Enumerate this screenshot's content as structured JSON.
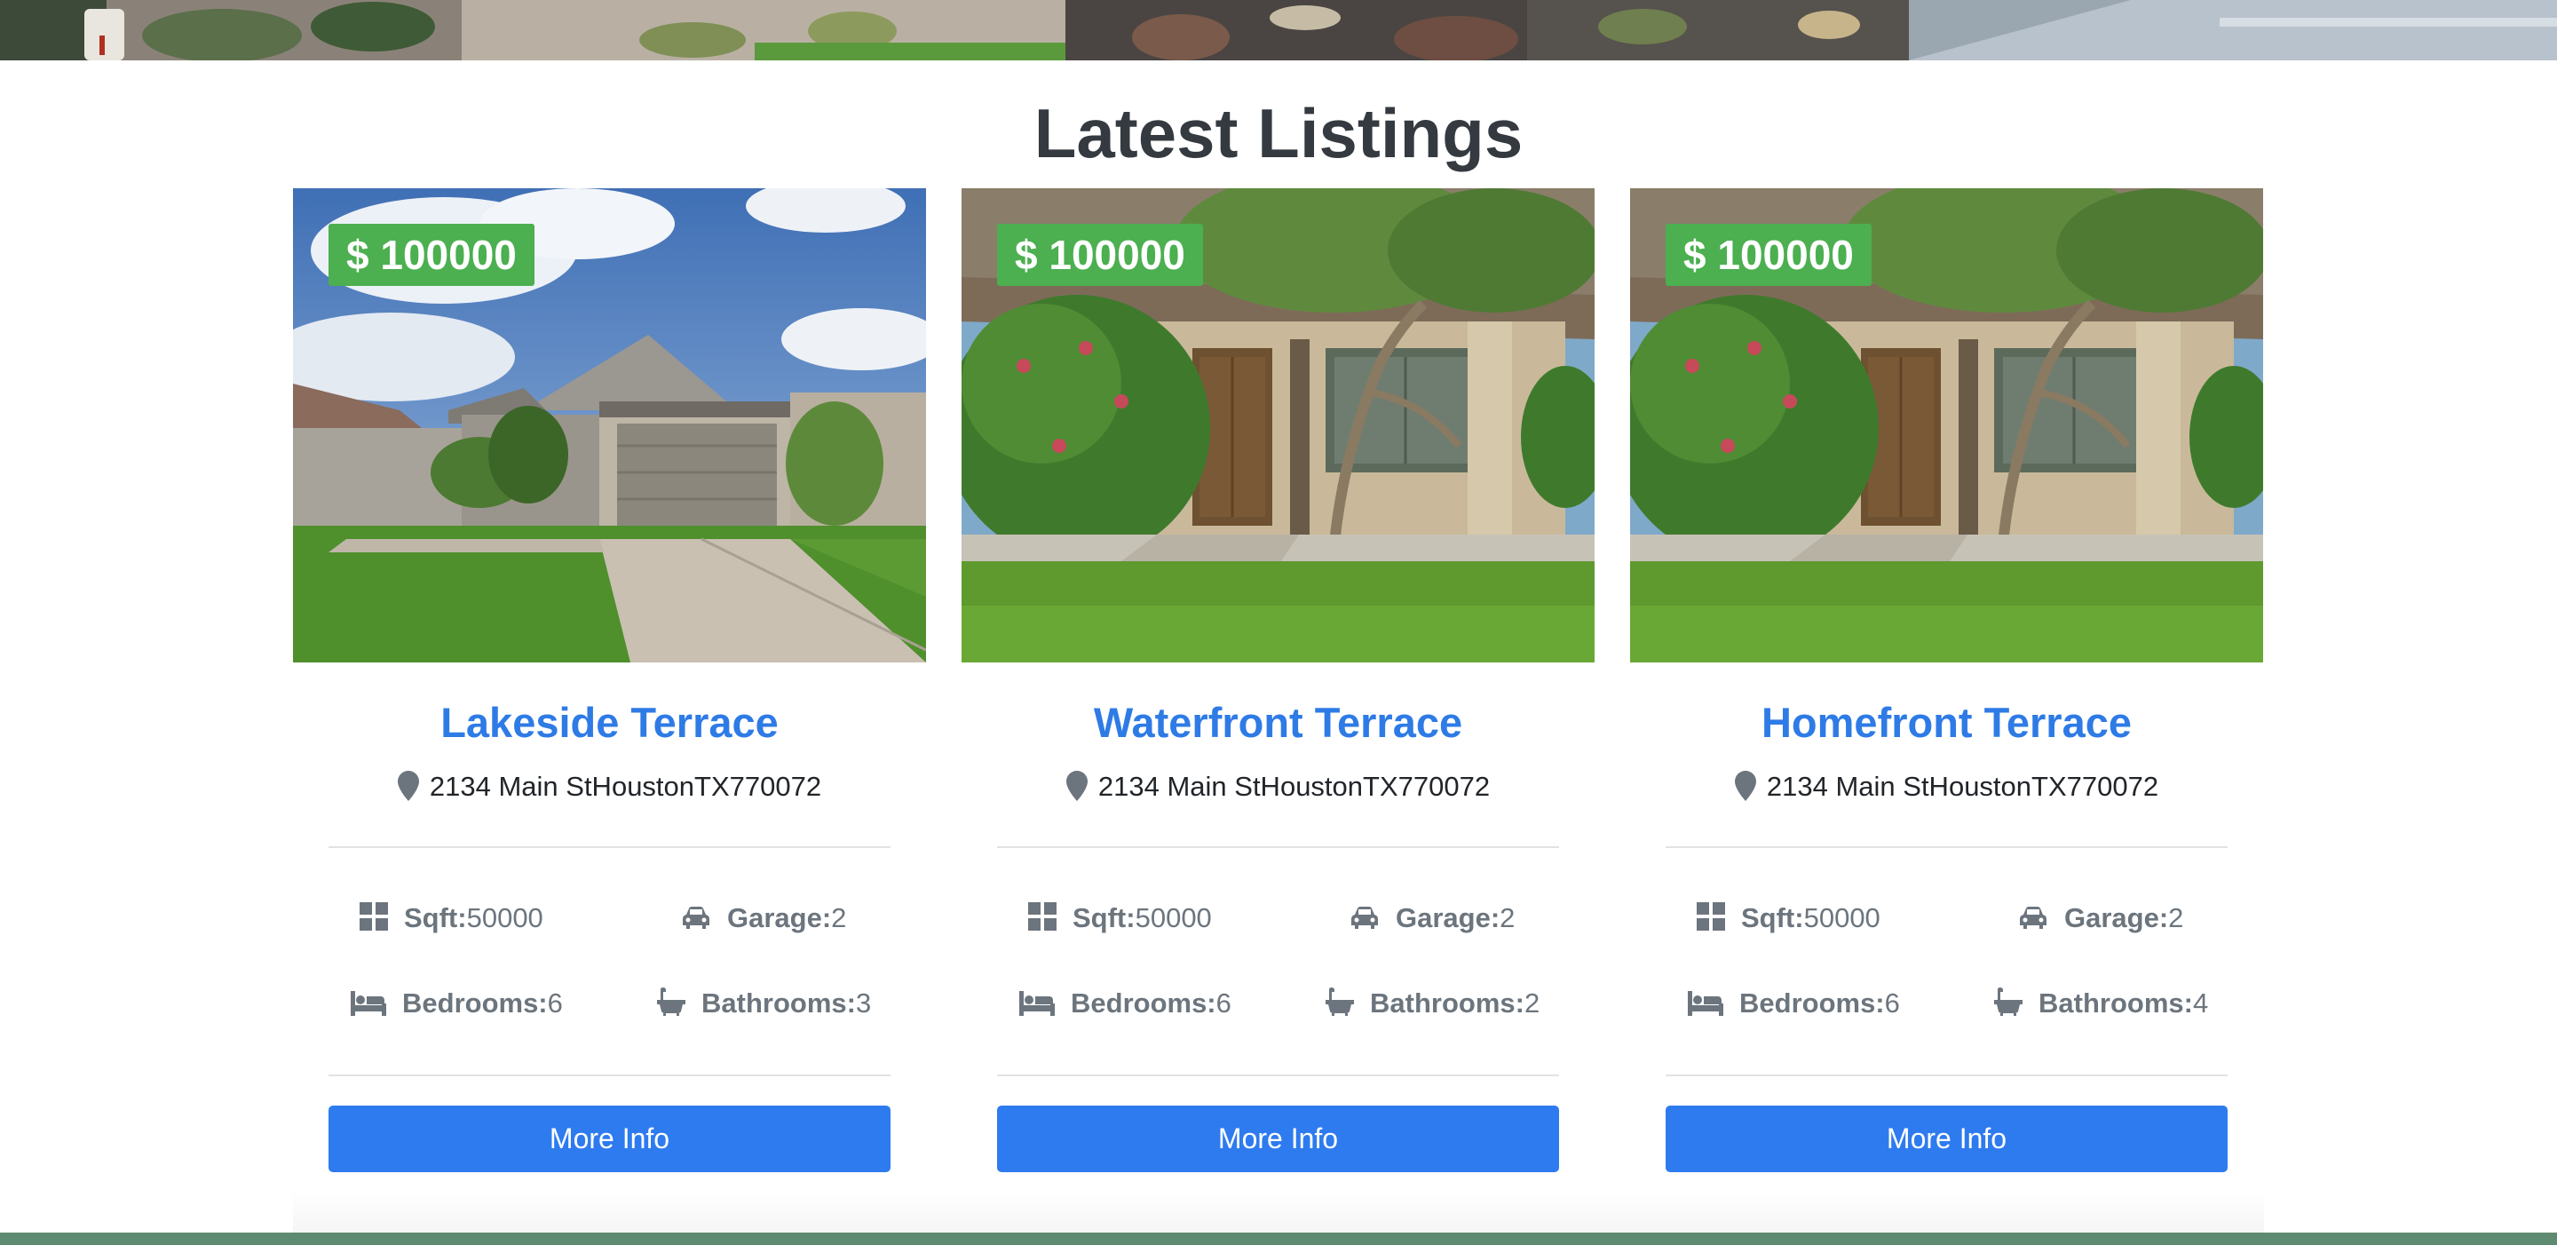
{
  "page": {
    "section_title": "Latest Listings"
  },
  "colors": {
    "price_badge": "#4caf50",
    "title_link": "#2e7be6",
    "button": "#2e7bef",
    "feature_text": "#6c757d",
    "footer": "#5f8a72"
  },
  "listings": [
    {
      "price": "$ 100000",
      "title": "Lakeside Terrace",
      "address": "2134 Main StHoustonTX770072",
      "sqft_label": "Sqft:",
      "sqft_value": "50000",
      "garage_label": "Garage:",
      "garage_value": "2",
      "bedrooms_label": "Bedrooms:",
      "bedrooms_value": "6",
      "bathrooms_label": "Bathrooms:",
      "bathrooms_value": "3",
      "button_label": "More Info",
      "photo": "house-photo-garage"
    },
    {
      "price": "$ 100000",
      "title": "Waterfront Terrace",
      "address": "2134 Main StHoustonTX770072",
      "sqft_label": "Sqft:",
      "sqft_value": "50000",
      "garage_label": "Garage:",
      "garage_value": "2",
      "bedrooms_label": "Bedrooms:",
      "bedrooms_value": "6",
      "bathrooms_label": "Bathrooms:",
      "bathrooms_value": "2",
      "button_label": "More Info",
      "photo": "house-photo-front-door"
    },
    {
      "price": "$ 100000",
      "title": "Homefront Terrace",
      "address": "2134 Main StHoustonTX770072",
      "sqft_label": "Sqft:",
      "sqft_value": "50000",
      "garage_label": "Garage:",
      "garage_value": "2",
      "bedrooms_label": "Bedrooms:",
      "bedrooms_value": "6",
      "bathrooms_label": "Bathrooms:",
      "bathrooms_value": "4",
      "button_label": "More Info",
      "photo": "house-photo-front-door"
    }
  ],
  "icons": {
    "address": "map-marker-icon",
    "sqft": "th-large-icon",
    "garage": "car-icon",
    "bedrooms": "bed-icon",
    "bathrooms": "bath-icon"
  }
}
